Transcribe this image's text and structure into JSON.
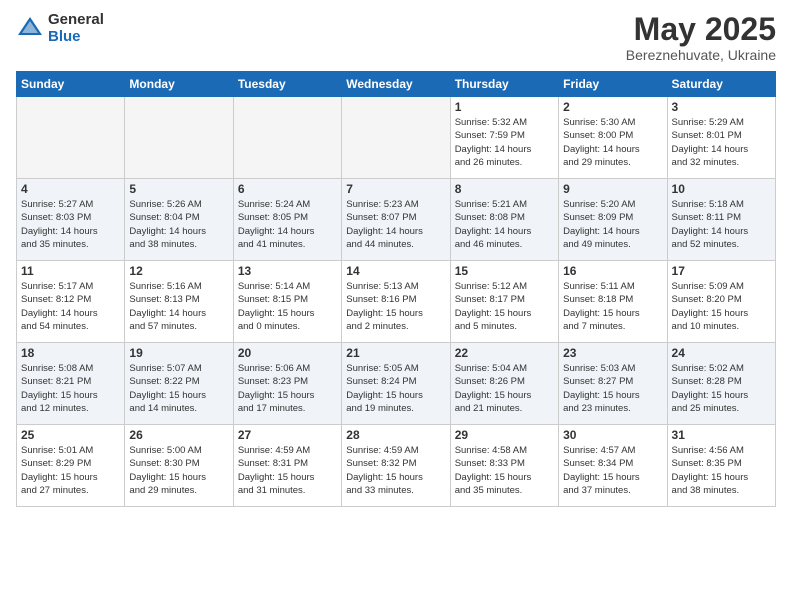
{
  "header": {
    "logo_general": "General",
    "logo_blue": "Blue",
    "month_title": "May 2025",
    "location": "Bereznehuvate, Ukraine"
  },
  "weekdays": [
    "Sunday",
    "Monday",
    "Tuesday",
    "Wednesday",
    "Thursday",
    "Friday",
    "Saturday"
  ],
  "weeks": [
    [
      {
        "day": "",
        "info": ""
      },
      {
        "day": "",
        "info": ""
      },
      {
        "day": "",
        "info": ""
      },
      {
        "day": "",
        "info": ""
      },
      {
        "day": "1",
        "info": "Sunrise: 5:32 AM\nSunset: 7:59 PM\nDaylight: 14 hours\nand 26 minutes."
      },
      {
        "day": "2",
        "info": "Sunrise: 5:30 AM\nSunset: 8:00 PM\nDaylight: 14 hours\nand 29 minutes."
      },
      {
        "day": "3",
        "info": "Sunrise: 5:29 AM\nSunset: 8:01 PM\nDaylight: 14 hours\nand 32 minutes."
      }
    ],
    [
      {
        "day": "4",
        "info": "Sunrise: 5:27 AM\nSunset: 8:03 PM\nDaylight: 14 hours\nand 35 minutes."
      },
      {
        "day": "5",
        "info": "Sunrise: 5:26 AM\nSunset: 8:04 PM\nDaylight: 14 hours\nand 38 minutes."
      },
      {
        "day": "6",
        "info": "Sunrise: 5:24 AM\nSunset: 8:05 PM\nDaylight: 14 hours\nand 41 minutes."
      },
      {
        "day": "7",
        "info": "Sunrise: 5:23 AM\nSunset: 8:07 PM\nDaylight: 14 hours\nand 44 minutes."
      },
      {
        "day": "8",
        "info": "Sunrise: 5:21 AM\nSunset: 8:08 PM\nDaylight: 14 hours\nand 46 minutes."
      },
      {
        "day": "9",
        "info": "Sunrise: 5:20 AM\nSunset: 8:09 PM\nDaylight: 14 hours\nand 49 minutes."
      },
      {
        "day": "10",
        "info": "Sunrise: 5:18 AM\nSunset: 8:11 PM\nDaylight: 14 hours\nand 52 minutes."
      }
    ],
    [
      {
        "day": "11",
        "info": "Sunrise: 5:17 AM\nSunset: 8:12 PM\nDaylight: 14 hours\nand 54 minutes."
      },
      {
        "day": "12",
        "info": "Sunrise: 5:16 AM\nSunset: 8:13 PM\nDaylight: 14 hours\nand 57 minutes."
      },
      {
        "day": "13",
        "info": "Sunrise: 5:14 AM\nSunset: 8:15 PM\nDaylight: 15 hours\nand 0 minutes."
      },
      {
        "day": "14",
        "info": "Sunrise: 5:13 AM\nSunset: 8:16 PM\nDaylight: 15 hours\nand 2 minutes."
      },
      {
        "day": "15",
        "info": "Sunrise: 5:12 AM\nSunset: 8:17 PM\nDaylight: 15 hours\nand 5 minutes."
      },
      {
        "day": "16",
        "info": "Sunrise: 5:11 AM\nSunset: 8:18 PM\nDaylight: 15 hours\nand 7 minutes."
      },
      {
        "day": "17",
        "info": "Sunrise: 5:09 AM\nSunset: 8:20 PM\nDaylight: 15 hours\nand 10 minutes."
      }
    ],
    [
      {
        "day": "18",
        "info": "Sunrise: 5:08 AM\nSunset: 8:21 PM\nDaylight: 15 hours\nand 12 minutes."
      },
      {
        "day": "19",
        "info": "Sunrise: 5:07 AM\nSunset: 8:22 PM\nDaylight: 15 hours\nand 14 minutes."
      },
      {
        "day": "20",
        "info": "Sunrise: 5:06 AM\nSunset: 8:23 PM\nDaylight: 15 hours\nand 17 minutes."
      },
      {
        "day": "21",
        "info": "Sunrise: 5:05 AM\nSunset: 8:24 PM\nDaylight: 15 hours\nand 19 minutes."
      },
      {
        "day": "22",
        "info": "Sunrise: 5:04 AM\nSunset: 8:26 PM\nDaylight: 15 hours\nand 21 minutes."
      },
      {
        "day": "23",
        "info": "Sunrise: 5:03 AM\nSunset: 8:27 PM\nDaylight: 15 hours\nand 23 minutes."
      },
      {
        "day": "24",
        "info": "Sunrise: 5:02 AM\nSunset: 8:28 PM\nDaylight: 15 hours\nand 25 minutes."
      }
    ],
    [
      {
        "day": "25",
        "info": "Sunrise: 5:01 AM\nSunset: 8:29 PM\nDaylight: 15 hours\nand 27 minutes."
      },
      {
        "day": "26",
        "info": "Sunrise: 5:00 AM\nSunset: 8:30 PM\nDaylight: 15 hours\nand 29 minutes."
      },
      {
        "day": "27",
        "info": "Sunrise: 4:59 AM\nSunset: 8:31 PM\nDaylight: 15 hours\nand 31 minutes."
      },
      {
        "day": "28",
        "info": "Sunrise: 4:59 AM\nSunset: 8:32 PM\nDaylight: 15 hours\nand 33 minutes."
      },
      {
        "day": "29",
        "info": "Sunrise: 4:58 AM\nSunset: 8:33 PM\nDaylight: 15 hours\nand 35 minutes."
      },
      {
        "day": "30",
        "info": "Sunrise: 4:57 AM\nSunset: 8:34 PM\nDaylight: 15 hours\nand 37 minutes."
      },
      {
        "day": "31",
        "info": "Sunrise: 4:56 AM\nSunset: 8:35 PM\nDaylight: 15 hours\nand 38 minutes."
      }
    ]
  ]
}
